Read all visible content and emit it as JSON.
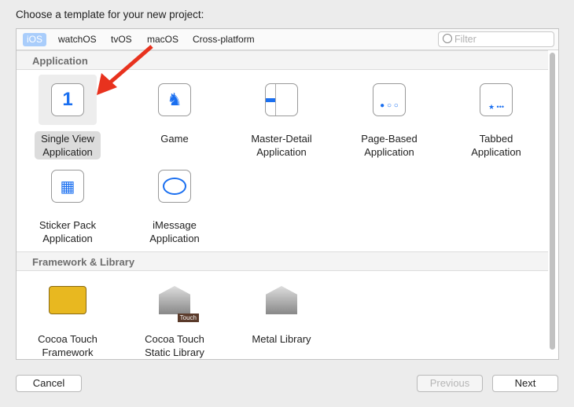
{
  "title": "Choose a template for your new project:",
  "tabs": [
    "iOS",
    "watchOS",
    "tvOS",
    "macOS",
    "Cross-platform"
  ],
  "filter_placeholder": "Filter",
  "sections": [
    {
      "label": "Application",
      "items": [
        {
          "name": "Single View Application",
          "l1": "Single View",
          "l2": "Application",
          "icon": "1"
        },
        {
          "name": "Game",
          "l1": "Game",
          "l2": ""
        },
        {
          "name": "Master-Detail Application",
          "l1": "Master-Detail",
          "l2": "Application"
        },
        {
          "name": "Page-Based Application",
          "l1": "Page-Based",
          "l2": "Application"
        },
        {
          "name": "Tabbed Application",
          "l1": "Tabbed",
          "l2": "Application"
        },
        {
          "name": "Sticker Pack Application",
          "l1": "Sticker Pack",
          "l2": "Application"
        },
        {
          "name": "iMessage Application",
          "l1": "iMessage",
          "l2": "Application"
        }
      ]
    },
    {
      "label": "Framework & Library",
      "items": [
        {
          "l1": "Cocoa Touch",
          "l2": "Framework"
        },
        {
          "l1": "Cocoa Touch",
          "l2": "Static Library",
          "badge": "Touch"
        },
        {
          "l1": "Metal Library",
          "l2": ""
        }
      ]
    }
  ],
  "buttons": {
    "cancel": "Cancel",
    "previous": "Previous",
    "next": "Next"
  },
  "colors": {
    "accent": "#1a6ff0",
    "arrow": "#e8321e"
  }
}
